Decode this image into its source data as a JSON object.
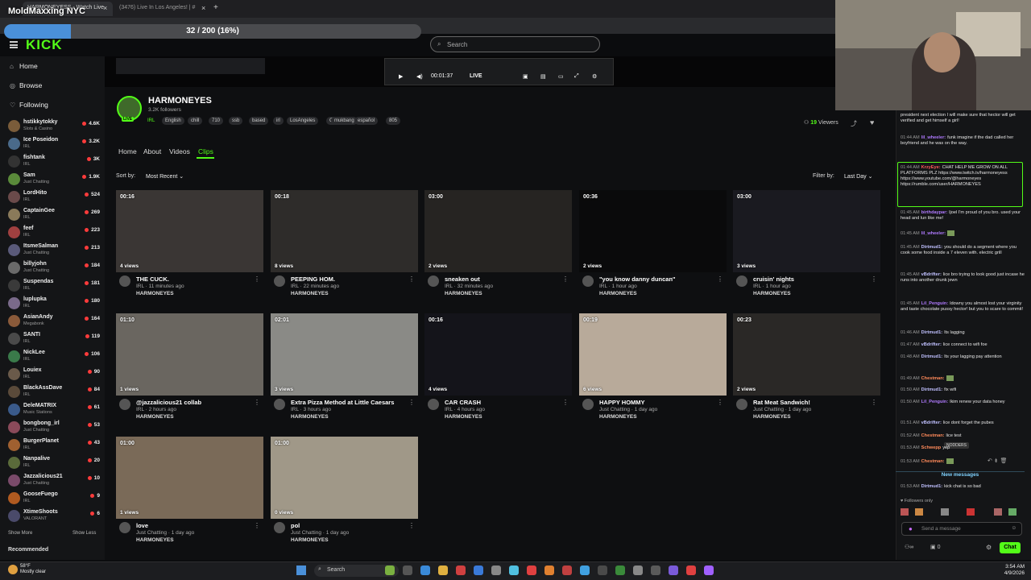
{
  "overlay": {
    "title": "MoldMaxxing NYC",
    "progress_text": "32 / 200 (16%)",
    "progress_fraction": 0.16
  },
  "browser": {
    "tabs": [
      "HARMONEYESS - Watch Live",
      "(3476) Live In Los Angeles! | #"
    ],
    "new_tab": "+",
    "tab_close": "×"
  },
  "header": {
    "logo": "KICK",
    "search_placeholder": "Search"
  },
  "sidebar": {
    "home": "Home",
    "browse": "Browse",
    "following": "Following",
    "follows": [
      {
        "name": "hstikkytokky",
        "cat": "Slots & Casino",
        "viewers": "4.6K",
        "color": "#7a5c3a"
      },
      {
        "name": "Ice Poseidon",
        "cat": "IRL",
        "viewers": "3.2K",
        "color": "#4a6a8a"
      },
      {
        "name": "fishtank",
        "cat": "IRL",
        "viewers": "3K",
        "color": "#333"
      },
      {
        "name": "Sam",
        "cat": "Just Chatting",
        "viewers": "1.9K",
        "color": "#5a8a3a"
      },
      {
        "name": "LordHito",
        "cat": "IRL",
        "viewers": "524",
        "color": "#6a4a4a"
      },
      {
        "name": "CaptainGee",
        "cat": "IRL",
        "viewers": "269",
        "color": "#8a7a5a"
      },
      {
        "name": "feef",
        "cat": "IRL",
        "viewers": "223",
        "color": "#a04040"
      },
      {
        "name": "ItsmeSalman",
        "cat": "Just Chatting",
        "viewers": "213",
        "color": "#5a5a7a"
      },
      {
        "name": "billyjohn",
        "cat": "Just Chatting",
        "viewers": "184",
        "color": "#6a6a6a"
      },
      {
        "name": "Suspendas",
        "cat": "IRL",
        "viewers": "181",
        "color": "#3a3a3a"
      },
      {
        "name": "luplupka",
        "cat": "IRL",
        "viewers": "180",
        "color": "#7a6a8a"
      },
      {
        "name": "AsianAndy",
        "cat": "Megabonk",
        "viewers": "164",
        "color": "#8a5a3a"
      },
      {
        "name": "SANTI",
        "cat": "IRL",
        "viewers": "119",
        "color": "#4a4a4a"
      },
      {
        "name": "NickLee",
        "cat": "IRL",
        "viewers": "106",
        "color": "#3a7a4a"
      },
      {
        "name": "Louiex",
        "cat": "IRL",
        "viewers": "90",
        "color": "#6a5a4a"
      },
      {
        "name": "BlackAssDave",
        "cat": "IRL",
        "viewers": "84",
        "color": "#5a4a3a"
      },
      {
        "name": "DeleMATRIX",
        "cat": "Music Stations",
        "viewers": "61",
        "color": "#3a5a8a"
      },
      {
        "name": "bongbong_irl",
        "cat": "Just Chatting",
        "viewers": "53",
        "color": "#8a4a5a"
      },
      {
        "name": "BurgerPlanet",
        "cat": "IRL",
        "viewers": "43",
        "color": "#a06030"
      },
      {
        "name": "Nanpalive",
        "cat": "IRL",
        "viewers": "20",
        "color": "#5a6a3a"
      },
      {
        "name": "Jazzalicious21",
        "cat": "Just Chatting",
        "viewers": "10",
        "color": "#7a4a6a"
      },
      {
        "name": "GooseFuego",
        "cat": "IRL",
        "viewers": "9",
        "color": "#b05a20"
      },
      {
        "name": "XtimeShoots",
        "cat": "VALORANT",
        "viewers": "6",
        "color": "#4a4a6a"
      }
    ],
    "show_more": "Show More",
    "show_less": "Show Less",
    "recommended": "Recommended"
  },
  "player": {
    "time": "00:01:37",
    "live": "LIVE"
  },
  "channel": {
    "name": "HARMONEYES",
    "followers": "3.2K followers",
    "live_badge": "LIVE",
    "tags": [
      "IRL",
      "English",
      "chill",
      "710",
      "ssb",
      "based",
      "irl",
      "LosAngeles",
      "Cx",
      "mukbang",
      "español",
      "805"
    ],
    "viewers_count": "19",
    "viewers_label": "Viewers",
    "tabs": [
      "Home",
      "About",
      "Videos",
      "Clips"
    ],
    "sort_label": "Sort by:",
    "sort_value": "Most Recent",
    "filter_label": "Filter by:",
    "filter_value": "Last Day"
  },
  "clips": [
    {
      "dur": "00:16",
      "views": "4 views",
      "title": "THE CUCK.",
      "meta": "IRL · 11 minutes ago",
      "channel": "HARMONEYES",
      "bg": "#3a3634"
    },
    {
      "dur": "00:18",
      "views": "8 views",
      "title": "PEEPING HOM.",
      "meta": "IRL · 22 minutes ago",
      "channel": "HARMONEYES",
      "bg": "#2e2c2a"
    },
    {
      "dur": "03:00",
      "views": "2 views",
      "title": "sneaken out",
      "meta": "IRL · 32 minutes ago",
      "channel": "HARMONEYES",
      "bg": "#262422"
    },
    {
      "dur": "00:36",
      "views": "2 views",
      "title": "\"you know danny duncan\"",
      "meta": "IRL · 1 hour ago",
      "channel": "HARMONEYES",
      "bg": "#0a0a0b"
    },
    {
      "dur": "03:00",
      "views": "3 views",
      "title": "cruisin' nights",
      "meta": "IRL · 1 hour ago",
      "channel": "HARMONEYES",
      "bg": "#1a1a20"
    },
    {
      "dur": "01:10",
      "views": "1 views",
      "title": "@jazzalicious21 collab",
      "meta": "IRL · 2 hours ago",
      "channel": "HARMONEYES",
      "bg": "#6a6660"
    },
    {
      "dur": "02:01",
      "views": "3 views",
      "title": "Extra Pizza Method at Little Caesars",
      "meta": "IRL · 3 hours ago",
      "channel": "HARMONEYES",
      "bg": "#8a8a86"
    },
    {
      "dur": "00:16",
      "views": "4 views",
      "title": "CAR CRASH",
      "meta": "IRL · 4 hours ago",
      "channel": "HARMONEYES",
      "bg": "#14141a"
    },
    {
      "dur": "00:19",
      "views": "6 views",
      "title": "HAPPY HOMMY",
      "meta": "Just Chatting · 1 day ago",
      "channel": "HARMONEYES",
      "bg": "#b8aa9a"
    },
    {
      "dur": "00:23",
      "views": "2 views",
      "title": "Rat Meat Sandwich!",
      "meta": "Just Chatting · 1 day ago",
      "channel": "HARMONEYES",
      "bg": "#2a2826"
    },
    {
      "dur": "01:00",
      "views": "1 views",
      "title": "love",
      "meta": "Just Chatting · 1 day ago",
      "channel": "HARMONEYES",
      "bg": "#7a6a58"
    },
    {
      "dur": "01:00",
      "views": "0 views",
      "title": "pol",
      "meta": "Just Chatting · 1 day ago",
      "channel": "HARMONEYES",
      "bg": "#a09888"
    }
  ],
  "chat": {
    "messages": [
      {
        "ts": "",
        "user": "",
        "color": "#e6e6e6",
        "text": "president next election I will make sure that hector will get verified and get himself a girl!"
      },
      {
        "ts": "01:44 AM",
        "user": "lil_wheeler:",
        "color": "#b07aff",
        "text": "funk imagine if the dad called her boyfriend and he was on the way."
      },
      {
        "ts": "01:44 AM",
        "user": "KrzyEye:",
        "color": "#ff5a5a",
        "text": "CHAT HELP ME GROW ON ALL PLATFORMS PLZ https://www.twitch.tv/harmoneyess https://www.youtube.com/@harmoneyes https://rumble.com/user/HARMONEYES"
      },
      {
        "ts": "01:45 AM",
        "user": "birthdaypar:",
        "color": "#b07aff",
        "text": "ljoel I'm proud of you bro. used your head and lun like me!"
      },
      {
        "ts": "01:45 AM",
        "user": "lil_wheeler:",
        "color": "#b07aff",
        "text": ""
      },
      {
        "ts": "01:45 AM",
        "user": "Dirtmud1:",
        "color": "#c0c0ff",
        "text": "you should do a segment where you cook some food inside a 7 eleven with. electric grill"
      },
      {
        "ts": "01:45 AM",
        "user": "vBdrifter:",
        "color": "#c0c0ff",
        "text": "lice bro trying to look good just incase he runs into another drunk jewn"
      },
      {
        "ts": "01:45 AM",
        "user": "Lil_Penguin:",
        "color": "#b07aff",
        "text": "ldowny you almost lost your virginity and taste chocolate pussy hector! but you to scare to commit!"
      },
      {
        "ts": "01:46 AM",
        "user": "Dirtmud1:",
        "color": "#c0c0ff",
        "text": "Its lagging"
      },
      {
        "ts": "01:47 AM",
        "user": "vBdrifter:",
        "color": "#c0c0ff",
        "text": "lice connect to wifi foe"
      },
      {
        "ts": "01:48 AM",
        "user": "Dirtmud1:",
        "color": "#c0c0ff",
        "text": "Its your lagging pay attention"
      },
      {
        "ts": "01:49 AM",
        "user": "Chestman:",
        "color": "#ff8a5a",
        "text": ""
      },
      {
        "ts": "01:50 AM",
        "user": "Dirtmud1:",
        "color": "#c0c0ff",
        "text": "fix wifi"
      },
      {
        "ts": "01:50 AM",
        "user": "Lil_Penguin:",
        "color": "#b07aff",
        "text": "lkim renew your data honey"
      },
      {
        "ts": "01:51 AM",
        "user": "vBdrifter:",
        "color": "#c0c0ff",
        "text": "lice dont forget the pubes"
      },
      {
        "ts": "01:52 AM",
        "user": "Chestman:",
        "color": "#ff8a5a",
        "text": "lice test"
      },
      {
        "ts": "01:53 AM",
        "user": "Schwepp",
        "color": "#ff8a5a",
        "text": "yep"
      },
      {
        "ts": "01:53 AM",
        "user": "Chestman:",
        "color": "#ff8a5a",
        "text": ""
      },
      {
        "ts": "01:53 AM",
        "user": "Dirtmud1:",
        "color": "#c0c0ff",
        "text": "kick chat is so bad"
      }
    ],
    "tooltip": "NODDERS",
    "new_messages": "New messages",
    "followers_only": "Followers only",
    "input_placeholder": "Send a message",
    "count": "0",
    "send": "Chat"
  },
  "taskbar": {
    "search": "Search",
    "weather_temp": "58°F",
    "weather_desc": "Mostly clear",
    "time": "3:54 AM",
    "date": "4/9/2026"
  }
}
